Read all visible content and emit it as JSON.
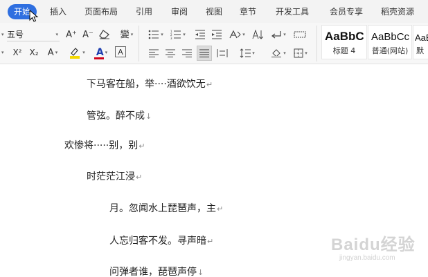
{
  "menu": {
    "tabs": [
      {
        "label": "开始"
      },
      {
        "label": "插入"
      },
      {
        "label": "页面布局"
      },
      {
        "label": "引用"
      },
      {
        "label": "审阅"
      },
      {
        "label": "视图"
      },
      {
        "label": "章节"
      },
      {
        "label": "开发工具"
      },
      {
        "label": "会员专享"
      },
      {
        "label": "稻壳资源"
      }
    ],
    "active_tab": "开始"
  },
  "ribbon": {
    "font_size_value": "五号",
    "icons": {
      "grow_font": "A⁺",
      "shrink_font": "A⁻",
      "clear_format": "⌫",
      "phonetic": "變",
      "superscript": "X²",
      "subscript": "X₂",
      "text_effect": "A",
      "highlight": "A",
      "font_color": "A",
      "char_border": "A"
    },
    "colors": {
      "highlight": "#f5d800",
      "font_color": "#d0021b",
      "accent": "#2f6fe0"
    },
    "styles": [
      {
        "sample": "AaBbC",
        "label": "标题 4"
      },
      {
        "sample": "AaBbCc",
        "label": "普通(网站)"
      },
      {
        "sample": "AaB",
        "label": "默"
      }
    ]
  },
  "document": {
    "lines": [
      {
        "text": "下马客在船，举····酒欲饮无",
        "mark": "↵"
      },
      {
        "text": "管弦。醉不成",
        "mark": "↓"
      },
      {
        "text": "欢惨将·····别，别",
        "mark": "↵"
      },
      {
        "text": "时茫茫江浸",
        "mark": "↵"
      },
      {
        "text": "月。忽闻水上琵琶声，主",
        "mark": "↵"
      },
      {
        "text": "人忘归客不发。寻声暗",
        "mark": "↵"
      },
      {
        "text": "问弹者谁，琵琶声停",
        "mark": "↓"
      }
    ]
  },
  "watermark": {
    "logo": "Baidu经验",
    "sub": "jingyan.baidu.com"
  }
}
